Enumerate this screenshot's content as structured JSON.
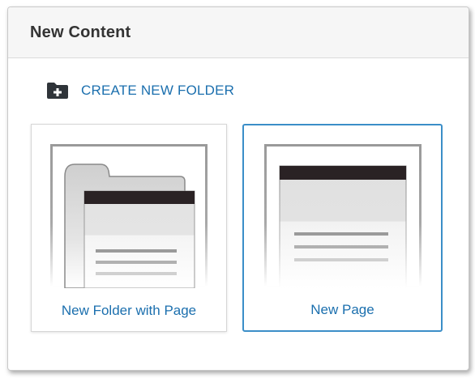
{
  "dialog": {
    "title": "New Content"
  },
  "create_folder": {
    "label": "CREATE NEW FOLDER",
    "icon": "folder-plus-icon"
  },
  "cards": [
    {
      "label": "New Folder with Page",
      "icon": "folder-with-page-thumbnail",
      "selected": false
    },
    {
      "label": "New Page",
      "icon": "page-thumbnail",
      "selected": true
    }
  ],
  "colors": {
    "link": "#1b6fae",
    "selected_border": "#3b8ec8",
    "header_bg": "#f6f6f6",
    "title_text": "#333333"
  }
}
